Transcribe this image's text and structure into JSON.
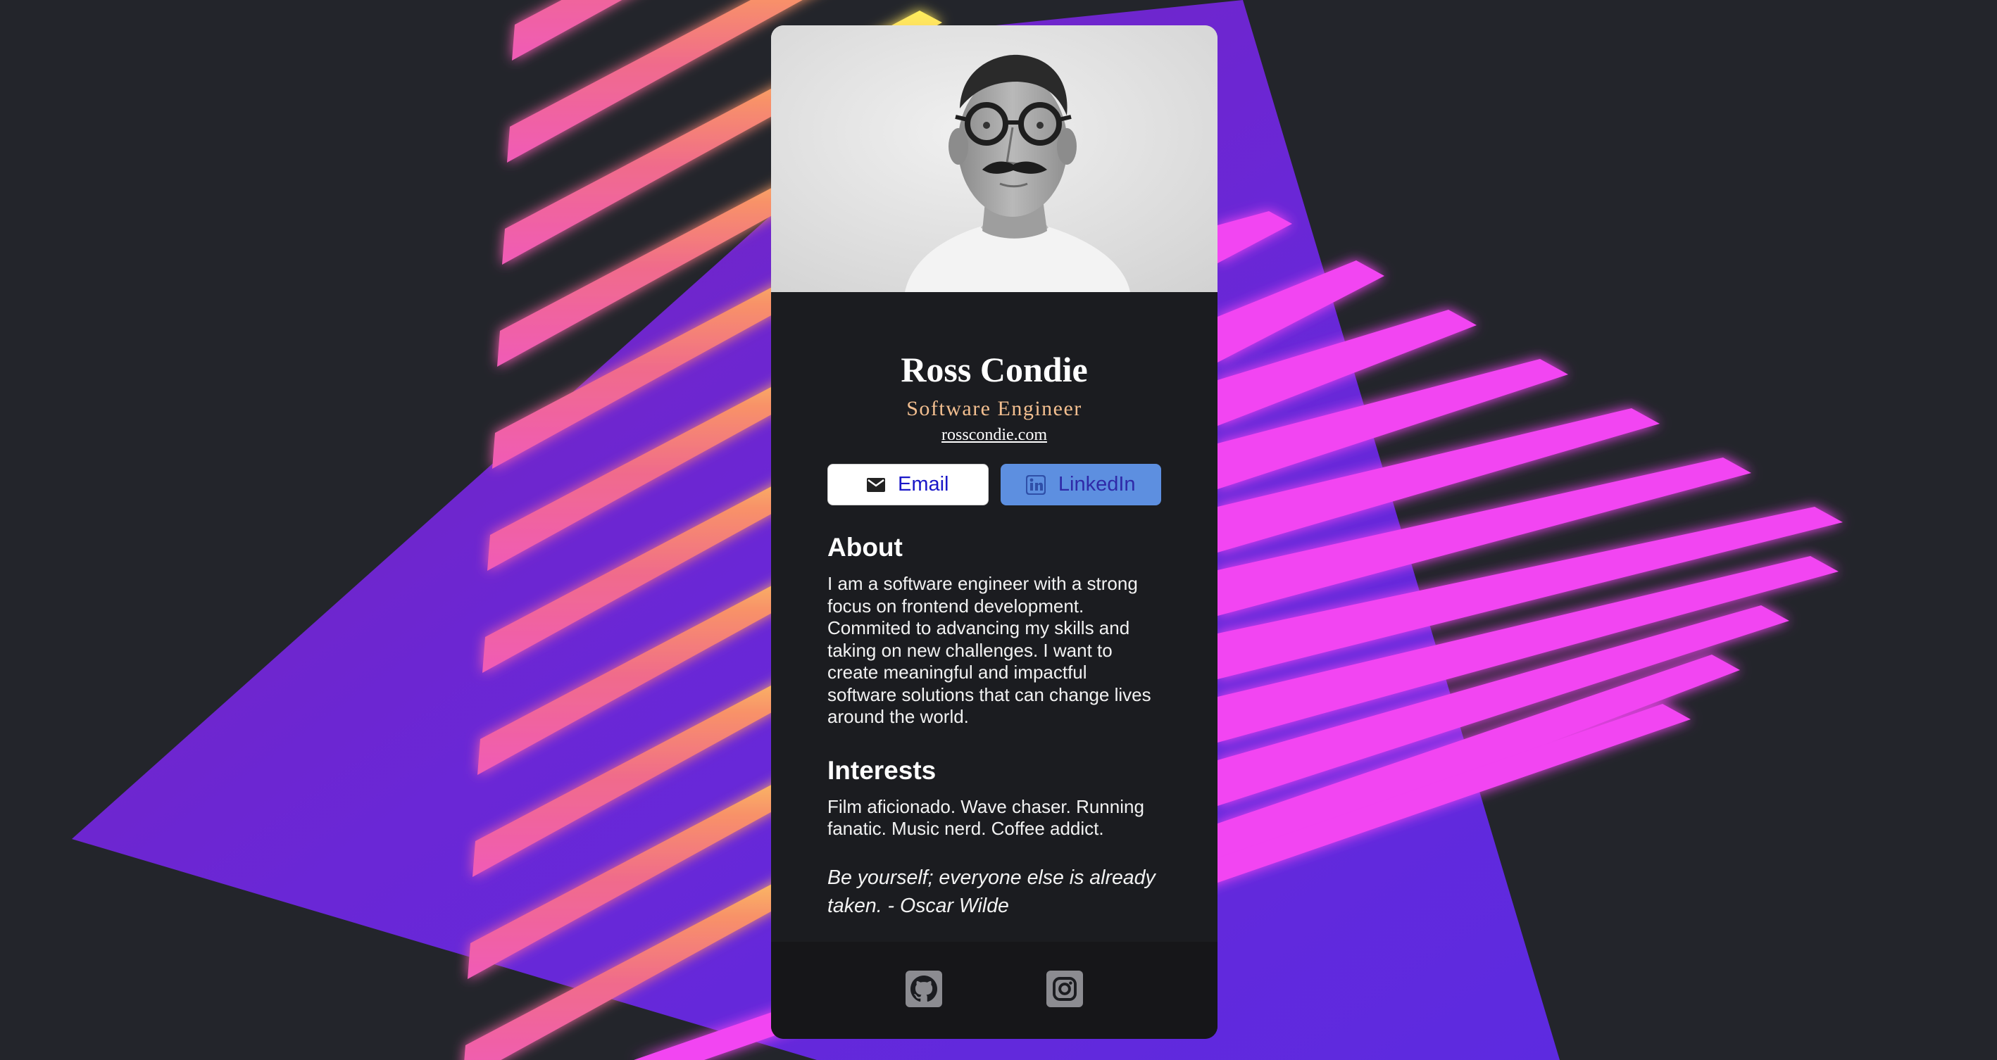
{
  "profile": {
    "name": "Ross Condie",
    "title": "Software Engineer",
    "website": "rosscondie.com"
  },
  "buttons": {
    "email_label": "Email",
    "linkedin_label": "LinkedIn"
  },
  "about": {
    "heading": "About",
    "text": "I am a software engineer with a strong focus on frontend development. Commited to advancing my skills and taking on new challenges. I want to create meaningful and impactful software solutions that can change lives around the world."
  },
  "interests": {
    "heading": "Interests",
    "text": "Film aficionado. Wave chaser. Running fanatic. Music nerd. Coffee addict."
  },
  "quote": "Be yourself; everyone else is already taken. - Oscar Wilde",
  "footer": {
    "icons": [
      "github-icon",
      "instagram-icon"
    ]
  },
  "colors": {
    "page_bg": "#23252b",
    "card_bg": "#1b1c20",
    "footer_bg": "#161619",
    "accent_title": "#f3bf90",
    "linkedin_button": "#5d8fe0",
    "triangle": "#6a27d6",
    "stripe_warm": "#ff8a5c",
    "stripe_pink": "#f244f2"
  }
}
